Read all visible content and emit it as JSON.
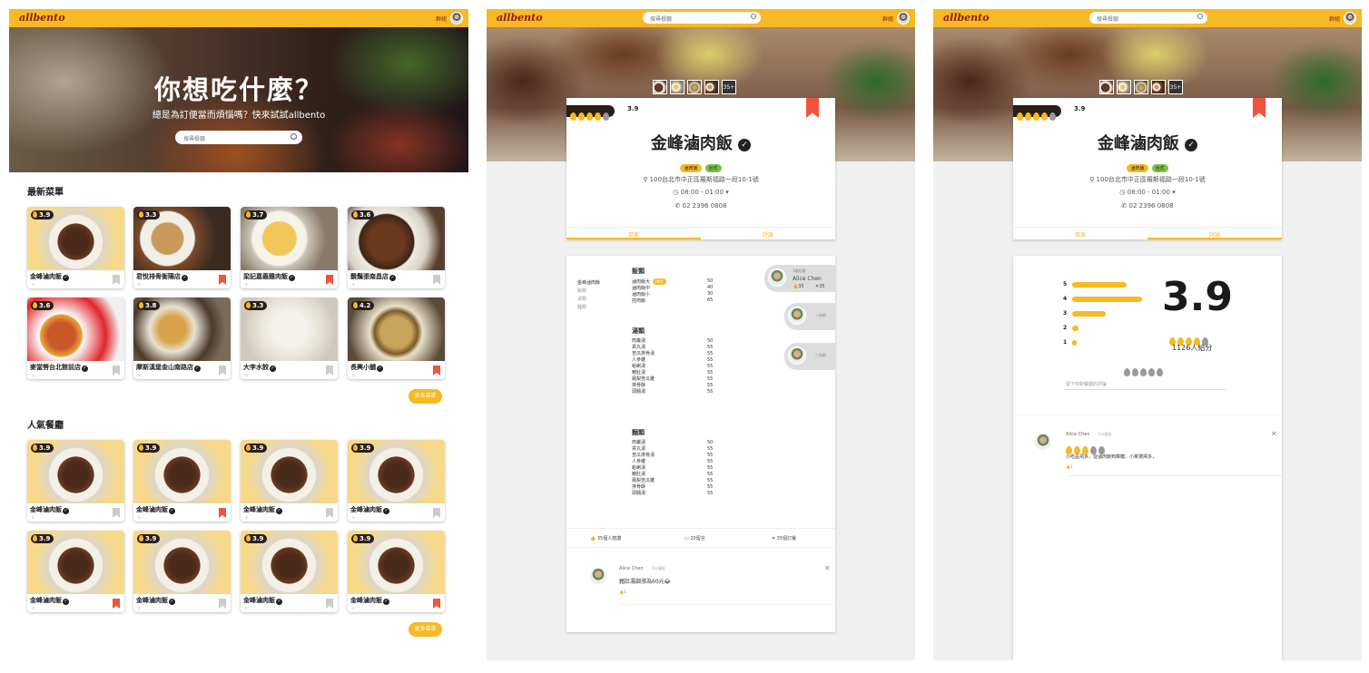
{
  "brand": {
    "logo": "allbento",
    "accent": "#f7b924",
    "logo_color": "#8a1f14"
  },
  "topbar": {
    "group_label": "群組",
    "search_placeholder": "搜尋餐廳"
  },
  "home": {
    "hero_title": "你想吃什麼？",
    "hero_subtitle": "總是為訂便當而煩惱嗎？快來試試allbento",
    "search_placeholder": "搜尋餐廳",
    "latest_title": "最新菜單",
    "popular_title": "人氣餐廳",
    "more_label": "更多菜單",
    "latest": [
      {
        "name": "金峰滷肉飯",
        "rating": "3.9",
        "bookmarked": false
      },
      {
        "name": "君悅排骨衡陽店",
        "rating": "3.3",
        "bookmarked": true
      },
      {
        "name": "梁記嘉義雞肉飯",
        "rating": "3.7",
        "bookmarked": true
      },
      {
        "name": "鬍鬚張南昌店",
        "rating": "3.6",
        "bookmarked": false
      },
      {
        "name": "麥當勞台北館前店",
        "rating": "3.6",
        "bookmarked": false
      },
      {
        "name": "摩斯漢堡金山南路店",
        "rating": "3.8",
        "bookmarked": false
      },
      {
        "name": "大李水餃",
        "rating": "3.3",
        "bookmarked": false
      },
      {
        "name": "長興小舖",
        "rating": "4.2",
        "bookmarked": true
      }
    ],
    "popular": [
      {
        "name": "金峰滷肉飯",
        "rating": "3.9",
        "bookmarked": false
      },
      {
        "name": "金峰滷肉飯",
        "rating": "3.9",
        "bookmarked": true
      },
      {
        "name": "金峰滷肉飯",
        "rating": "3.9",
        "bookmarked": false
      },
      {
        "name": "金峰滷肉飯",
        "rating": "3.9",
        "bookmarked": false
      },
      {
        "name": "金峰滷肉飯",
        "rating": "3.9",
        "bookmarked": true
      },
      {
        "name": "金峰滷肉飯",
        "rating": "3.9",
        "bookmarked": false
      },
      {
        "name": "金峰滷肉飯",
        "rating": "3.9",
        "bookmarked": false
      },
      {
        "name": "金峰滷肉飯",
        "rating": "3.9",
        "bookmarked": true
      }
    ]
  },
  "restaurant": {
    "name": "金峰滷肉飯",
    "rating": "3.9",
    "photo_more": "35+",
    "tags": [
      "滷肉飯",
      "台式"
    ],
    "address": "100台北市中正區羅斯福路一段10-1號",
    "hours": "08:00 - 01:00 ▾",
    "phone": "02 2396 0808",
    "tab_menu": "菜單",
    "tab_reviews": "評論"
  },
  "menu": {
    "side_title": "金峰滷肉飯",
    "side_items": [
      "飯類",
      "湯類",
      "麵類"
    ],
    "sections": [
      {
        "title": "飯類",
        "items": [
          [
            "滷肉飯大",
            "50"
          ],
          [
            "滷肉飯中",
            "40"
          ],
          [
            "滷肉飯小",
            "30"
          ],
          [
            "控肉飯",
            "65"
          ]
        ],
        "hot": "HOT"
      },
      {
        "title": "湯類",
        "items": [
          [
            "肉羹湯",
            "50"
          ],
          [
            "貢丸湯",
            "55"
          ],
          [
            "苦瓜排骨湯",
            "55"
          ],
          [
            "人參雞",
            "55"
          ],
          [
            "蛤蜊湯",
            "55"
          ],
          [
            "豬肚湯",
            "55"
          ],
          [
            "鳳梨苦瓜雞",
            "55"
          ],
          [
            "排骨酥",
            "55"
          ],
          [
            "頭髓湯",
            "55"
          ]
        ]
      },
      {
        "title": "麵類",
        "items": [
          [
            "肉羹湯",
            "50"
          ],
          [
            "貢丸湯",
            "55"
          ],
          [
            "苦瓜排骨湯",
            "55"
          ],
          [
            "人參雞",
            "55"
          ],
          [
            "蛤蜊湯",
            "55"
          ],
          [
            "豬肚湯",
            "55"
          ],
          [
            "鳳梨苦瓜雞",
            "55"
          ],
          [
            "排骨酥",
            "55"
          ],
          [
            "頭髓湯",
            "55"
          ]
        ]
      }
    ],
    "bubble1": {
      "time": "1個月前",
      "name": "Alice Chen",
      "likes": "35",
      "forks": "35"
    },
    "bubble2": {
      "time": "一年前"
    },
    "bubble3": {
      "time": "三年前"
    },
    "stats": {
      "likes": "35個人按讚",
      "comments": "20留言",
      "orders": "35個訂餐"
    },
    "comment": {
      "name": "Alice Chen",
      "time": "5分鐘前",
      "text": "豬肚湯調漲為60元😂",
      "likes": "1"
    }
  },
  "reviews": {
    "big_rating": "3.9",
    "count": "1126人給分",
    "levels": [
      {
        "label": "5",
        "pct": 0.7
      },
      {
        "label": "4",
        "pct": 0.9
      },
      {
        "label": "3",
        "pct": 0.43
      },
      {
        "label": "2",
        "pct": 0.08
      },
      {
        "label": "1",
        "pct": 0.04
      }
    ],
    "leave_placeholder": "留下你對餐廳的評論",
    "comment": {
      "name": "Alice Chen",
      "time": "5分鐘前",
      "text": "小吃品項多，從滷肉飯到庫糖，小菜選擇多，",
      "likes": "1"
    }
  }
}
